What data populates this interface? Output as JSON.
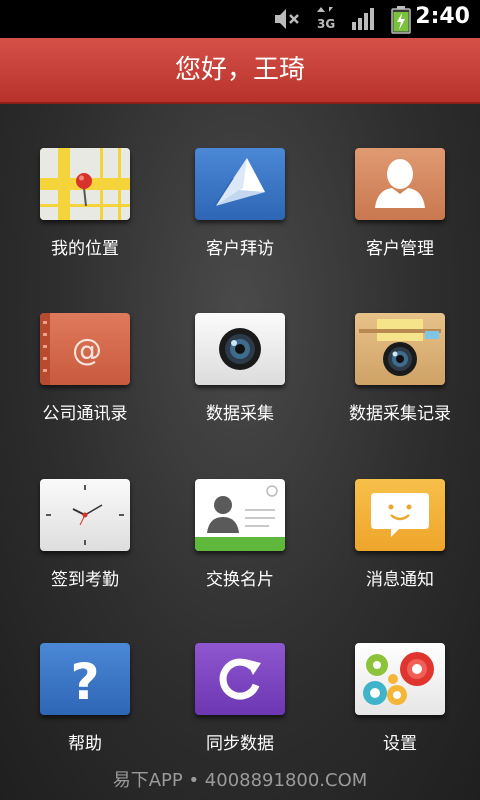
{
  "status_bar": {
    "time": "2:40",
    "network": "3G",
    "icons": [
      "mute-icon",
      "network-3g-icon",
      "signal-icon",
      "battery-charging-icon"
    ]
  },
  "header": {
    "title": "您好，王琦"
  },
  "grid": {
    "items": [
      {
        "label": "我的位置",
        "icon": "map-pin-icon"
      },
      {
        "label": "客户拜访",
        "icon": "paper-plane-icon"
      },
      {
        "label": "客户管理",
        "icon": "user-silhouette-icon"
      },
      {
        "label": "公司通讯录",
        "icon": "address-book-icon"
      },
      {
        "label": "数据采集",
        "icon": "camera-icon"
      },
      {
        "label": "数据采集记录",
        "icon": "camera-record-icon"
      },
      {
        "label": "签到考勤",
        "icon": "clock-icon"
      },
      {
        "label": "交换名片",
        "icon": "business-card-icon"
      },
      {
        "label": "消息通知",
        "icon": "chat-bubble-icon"
      },
      {
        "label": "帮助",
        "icon": "question-mark-icon"
      },
      {
        "label": "同步数据",
        "icon": "sync-icon"
      },
      {
        "label": "设置",
        "icon": "gears-icon"
      }
    ]
  },
  "footer": {
    "watermark": "易下APP • 4008891800.COM"
  },
  "colors": {
    "header": "#c23d35",
    "background": "#2b2b2b",
    "footer_text": "#9a9a9a"
  }
}
